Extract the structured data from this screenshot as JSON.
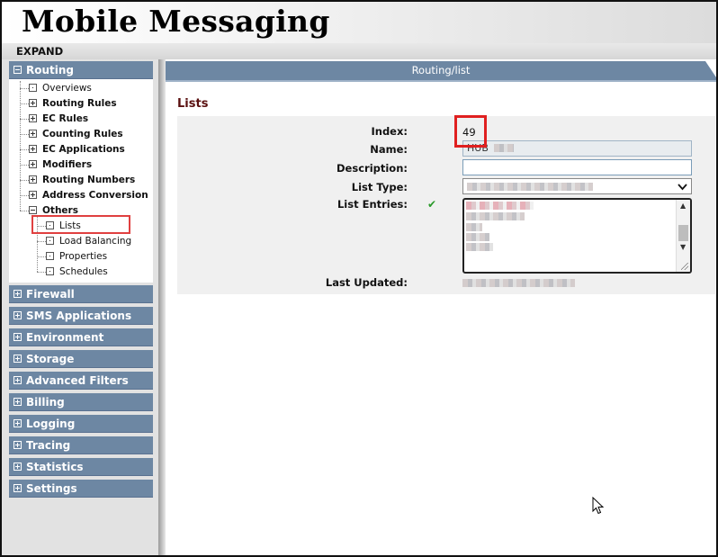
{
  "app": {
    "title": "Mobile Messaging",
    "expand_label": "EXPAND"
  },
  "sidebar": {
    "routing_section": {
      "label": "Routing",
      "expanded": true
    },
    "routing_tree": [
      {
        "label": "Overviews",
        "bold": false,
        "icon": "leaf"
      },
      {
        "label": "Routing Rules",
        "bold": true,
        "icon": "plus"
      },
      {
        "label": "EC Rules",
        "bold": true,
        "icon": "plus"
      },
      {
        "label": "Counting Rules",
        "bold": true,
        "icon": "plus"
      },
      {
        "label": "EC Applications",
        "bold": true,
        "icon": "plus"
      },
      {
        "label": "Modifiers",
        "bold": true,
        "icon": "plus"
      },
      {
        "label": "Routing Numbers",
        "bold": true,
        "icon": "plus"
      },
      {
        "label": "Address Conversion",
        "bold": true,
        "icon": "plus"
      },
      {
        "label": "Others",
        "bold": true,
        "icon": "minus"
      }
    ],
    "others_children": [
      {
        "label": "Lists",
        "selected": true
      },
      {
        "label": "Load Balancing",
        "selected": false
      },
      {
        "label": "Properties",
        "selected": false
      },
      {
        "label": "Schedules",
        "selected": false
      }
    ],
    "sections": [
      "Firewall",
      "SMS Applications",
      "Environment",
      "Storage",
      "Advanced Filters",
      "Billing",
      "Logging",
      "Tracing",
      "Statistics",
      "Settings"
    ]
  },
  "main": {
    "path": "Routing/list",
    "section_title": "Lists",
    "fields": {
      "index_label": "Index:",
      "index_value": "49",
      "name_label": "Name:",
      "name_value": "HUB",
      "description_label": "Description:",
      "description_value": "",
      "list_type_label": "List Type:",
      "list_entries_label": "List Entries:",
      "last_updated_label": "Last Updated:"
    }
  },
  "colors": {
    "nav_bar": "#6d87a3",
    "section_title": "#5a1010",
    "highlight": "#e02020",
    "valid_check": "#2a9a2a"
  },
  "icons": {
    "valid": "check-icon",
    "select": "chevron-down-icon",
    "pointer": "mouse-cursor-icon"
  }
}
